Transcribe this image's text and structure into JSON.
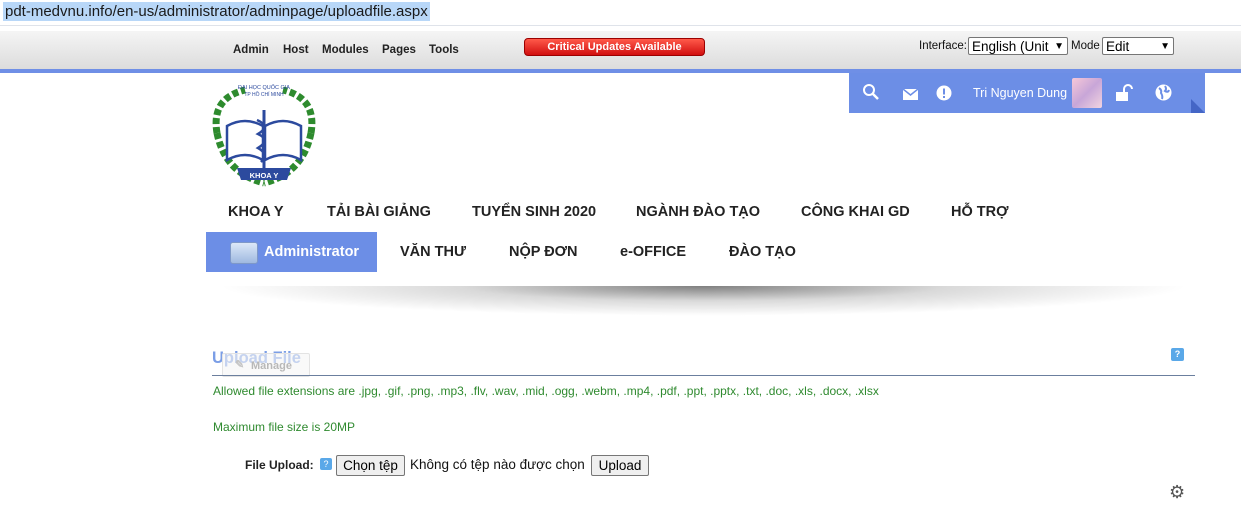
{
  "browser": {
    "url": "pdt-medvnu.info/en-us/administrator/adminpage/uploadfile.aspx"
  },
  "control_bar": {
    "menu": [
      "Admin",
      "Host",
      "Modules",
      "Pages",
      "Tools"
    ],
    "critical_updates": "Critical Updates Available",
    "interface_label": "Interface:",
    "interface_value": "English (Unit",
    "mode_label": "Mode",
    "mode_value": "Edit"
  },
  "user_panel": {
    "username": "Tri Nguyen Dung",
    "icons": [
      "search-icon",
      "mail-icon",
      "alert-icon",
      "avatar",
      "unlock-icon",
      "globe-icon"
    ]
  },
  "logo": {
    "text_top": "ĐẠI HỌC QUỐC GIA",
    "text_sub": "TP HỒ CHÍ MINH",
    "ribbon": "KHOA Y"
  },
  "nav_primary": [
    "KHOA Y",
    "TẢI BÀI GIẢNG",
    "TUYỂN SINH 2020",
    "NGÀNH ĐÀO TẠO",
    "CÔNG KHAI GD",
    "HỖ TRỢ"
  ],
  "nav_secondary": {
    "active": "Administrator",
    "items": [
      "VĂN THƯ",
      "NỘP ĐƠN",
      "e-OFFICE",
      "ĐÀO TẠO"
    ]
  },
  "module": {
    "title": "Upload File",
    "manage": "Manage",
    "allowed_ext": "Allowed file extensions are .jpg, .gif, .png, .mp3, .flv, .wav, .mid, .ogg, .webm, .mp4, .pdf, .ppt, .pptx, .txt, .doc, .xls, .docx, .xlsx",
    "max_size": "Maximum file size is 20MP",
    "file_upload_label": "File Upload:",
    "choose_button": "Chọn tệp",
    "no_file": "Không có tệp nào được chọn",
    "upload_button": "Upload"
  },
  "colors": {
    "accent": "#6c8ee6",
    "green_text": "#2f8a2f",
    "critical_red": "#d10f0f"
  }
}
